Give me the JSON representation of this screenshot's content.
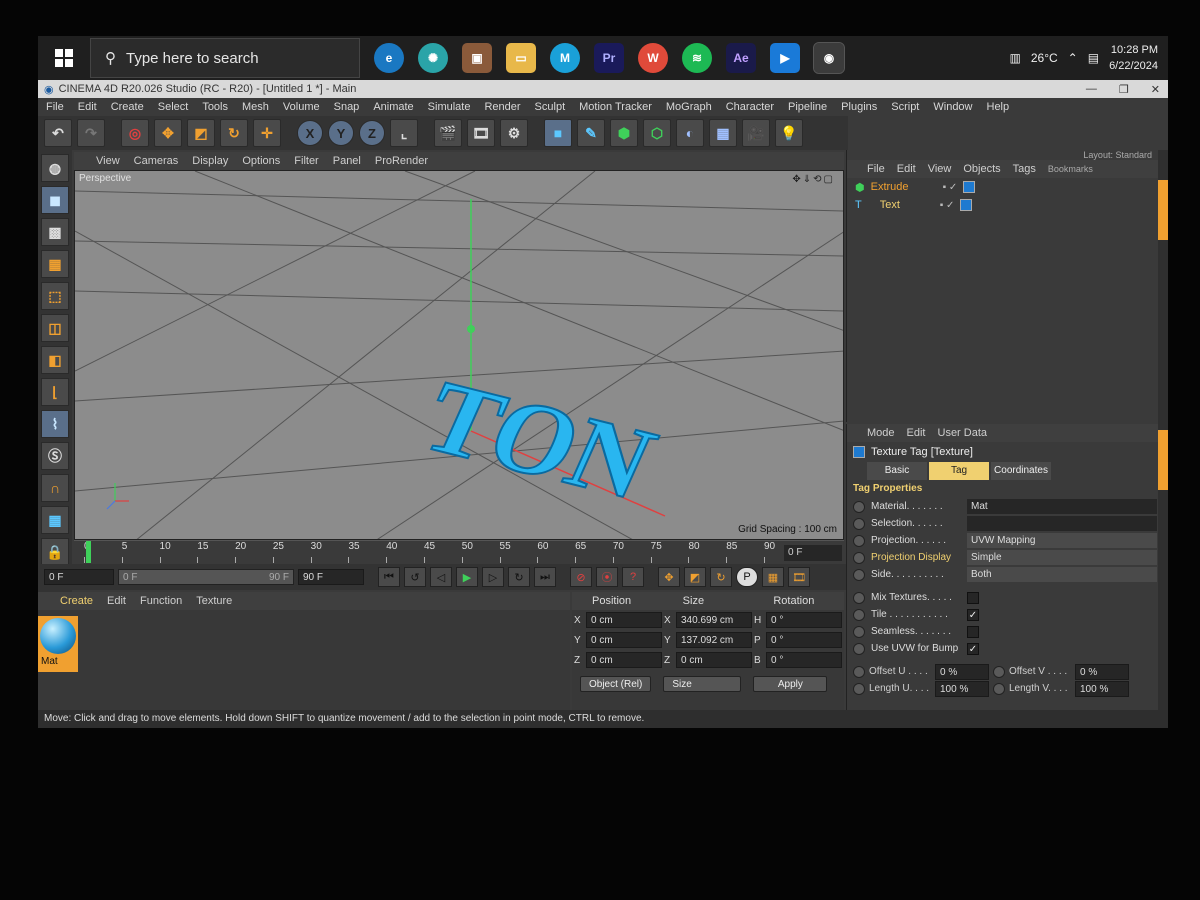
{
  "taskbar": {
    "search_placeholder": "Type here to search",
    "apps": [
      "Pr",
      "W",
      "Ae"
    ],
    "temperature": "26°C",
    "time": "10:28 PM",
    "date": "6/22/2024"
  },
  "window": {
    "title": "CINEMA 4D R20.026 Studio (RC - R20) - [Untitled 1 *] - Main"
  },
  "menubar": [
    "File",
    "Edit",
    "Create",
    "Select",
    "Tools",
    "Mesh",
    "Volume",
    "Snap",
    "Animate",
    "Simulate",
    "Render",
    "Sculpt",
    "Motion Tracker",
    "MoGraph",
    "Character",
    "Pipeline",
    "Plugins",
    "Script",
    "Window",
    "Help"
  ],
  "toolbar": {
    "axis_x": "X",
    "axis_y": "Y",
    "axis_z": "Z"
  },
  "viewport": {
    "menu": [
      "View",
      "Cameras",
      "Display",
      "Options",
      "Filter",
      "Panel",
      "ProRender"
    ],
    "label": "Perspective",
    "grid_spacing": "Grid Spacing : 100 cm",
    "object_text": "TON",
    "accent": "#29b6f0"
  },
  "timeline": {
    "ticks": [
      "0",
      "5",
      "10",
      "15",
      "20",
      "25",
      "30",
      "35",
      "40",
      "45",
      "50",
      "55",
      "60",
      "65",
      "70",
      "75",
      "80",
      "85",
      "90"
    ],
    "current_frame": "0 F"
  },
  "transport": {
    "start": "0 F",
    "slider_start": "0 F",
    "slider_end": "90 F",
    "end": "90 F"
  },
  "material_manager": {
    "menu": [
      "Create",
      "Edit",
      "Function",
      "Texture"
    ],
    "material_name": "Mat"
  },
  "coordinates": {
    "headers": [
      "Position",
      "Size",
      "Rotation"
    ],
    "rows": [
      {
        "pos_axis": "X",
        "pos": "0 cm",
        "size_axis": "X",
        "size": "340.699 cm",
        "rot_axis": "H",
        "rot": "0 °"
      },
      {
        "pos_axis": "Y",
        "pos": "0 cm",
        "size_axis": "Y",
        "size": "137.092 cm",
        "rot_axis": "P",
        "rot": "0 °"
      },
      {
        "pos_axis": "Z",
        "pos": "0 cm",
        "size_axis": "Z",
        "size": "0 cm",
        "rot_axis": "B",
        "rot": "0 °"
      }
    ],
    "mode": "Object (Rel)",
    "size_mode": "Size",
    "apply": "Apply"
  },
  "object_manager": {
    "layout_label": "Layout:",
    "layout_value": "Standard",
    "menu": [
      "File",
      "Edit",
      "View",
      "Objects",
      "Tags",
      "Bookmarks"
    ],
    "objects": [
      "Extrude",
      "Text"
    ]
  },
  "attributes": {
    "menu": [
      "Mode",
      "Edit",
      "User Data"
    ],
    "title": "Texture Tag [Texture]",
    "tabs": [
      "Basic",
      "Tag",
      "Coordinates"
    ],
    "section": "Tag Properties",
    "material_label": "Material. . . . . . .",
    "material_value": "Mat",
    "selection_label": "Selection. . . . . .",
    "projection_label": "Projection. . . . . .",
    "projection_value": "UVW Mapping",
    "projection_display_label": "Projection Display",
    "projection_display_value": "Simple",
    "side_label": "Side. . . . . . . . . .",
    "side_value": "Both",
    "mix_textures": "Mix Textures. . . . .",
    "tile": "Tile . . . . . . . . . . .",
    "seamless": "Seamless. . . . . . .",
    "use_uvw": "Use UVW for Bump",
    "offset_u_label": "Offset U . . . .",
    "offset_u": "0 %",
    "offset_v_label": "Offset V . . . .",
    "offset_v": "0 %",
    "length_u_label": "Length U. . . .",
    "length_u": "100 %",
    "length_v_label": "Length V. . . .",
    "length_v": "100 %"
  },
  "status": "Move: Click and drag to move elements. Hold down SHIFT to quantize movement / add to the selection in point mode, CTRL to remove."
}
